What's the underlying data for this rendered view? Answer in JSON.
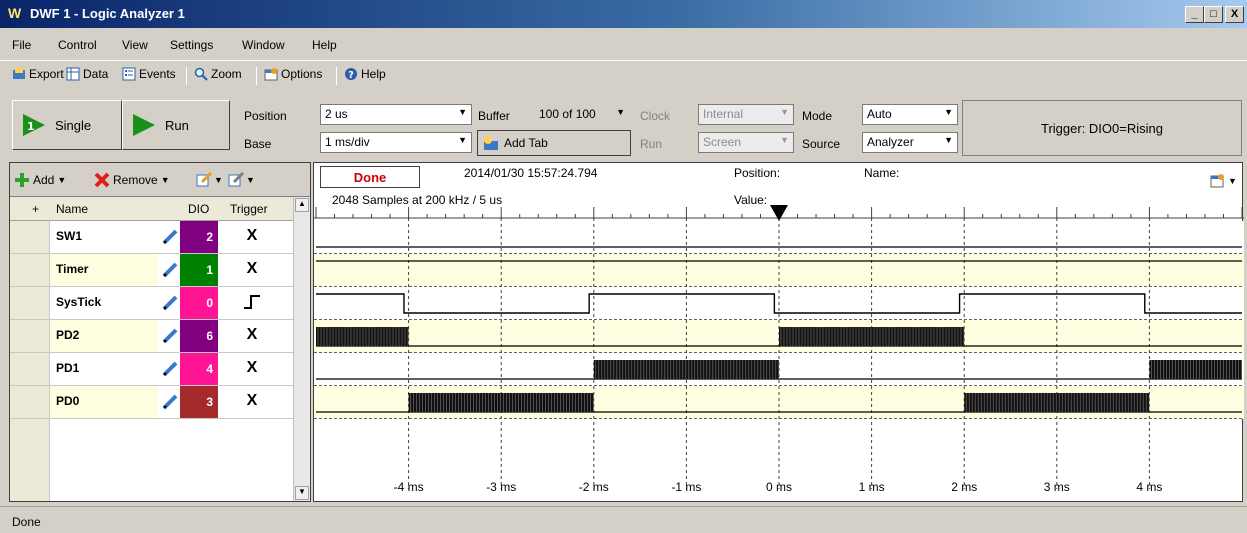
{
  "window": {
    "title": "DWF 1 - Logic Analyzer 1",
    "minimize": "_",
    "maximize": "□",
    "close": "X"
  },
  "menu": [
    "File",
    "Control",
    "View",
    "Settings",
    "Window",
    "Help"
  ],
  "toolbar": {
    "export": "Export",
    "data": "Data",
    "events": "Events",
    "zoom": "Zoom",
    "options": "Options",
    "help": "Help"
  },
  "control": {
    "single": "Single",
    "run": "Run",
    "position_label": "Position",
    "position_value": "2 us",
    "base_label": "Base",
    "base_value": "1 ms/div",
    "buffer_label": "Buffer",
    "buffer_value": "100 of 100",
    "add_tab": "Add Tab",
    "clock_label": "Clock",
    "clock_value": "Internal",
    "run_label": "Run",
    "run_value": "Screen",
    "mode_label": "Mode",
    "mode_value": "Auto",
    "source_label": "Source",
    "source_value": "Analyzer",
    "trigger_text": "Trigger: DIO0=Rising"
  },
  "channel_tools": {
    "add": "Add",
    "remove": "Remove"
  },
  "columns": {
    "plus": "+",
    "name": "Name",
    "dio": "DIO",
    "trigger": "Trigger"
  },
  "channels": [
    {
      "name": "SW1",
      "dio": "2",
      "trigger": "X",
      "dio_color": "#800080",
      "bg": "#ffffff"
    },
    {
      "name": "Timer",
      "dio": "1",
      "trigger": "X",
      "dio_color": "#008000",
      "bg": "#fffee0"
    },
    {
      "name": "SysTick",
      "dio": "0",
      "trigger": "rising-edge",
      "dio_color": "#ff1493",
      "bg": "#ffffff"
    },
    {
      "name": "PD2",
      "dio": "6",
      "trigger": "X",
      "dio_color": "#800080",
      "bg": "#fffee0"
    },
    {
      "name": "PD1",
      "dio": "4",
      "trigger": "X",
      "dio_color": "#ff1493",
      "bg": "#ffffff"
    },
    {
      "name": "PD0",
      "dio": "3",
      "trigger": "X",
      "dio_color": "#a52a2a",
      "bg": "#fffee0"
    }
  ],
  "acquisition": {
    "state": "Done",
    "timestamp": "2014/01/30  15:57:24.794",
    "samples": "2048 Samples at 200 kHz / 5 us",
    "position_label": "Position:",
    "value_label": "Value:",
    "name_label": "Name:"
  },
  "time_axis": {
    "labels": [
      "-4 ms",
      "-3 ms",
      "-2 ms",
      "-1 ms",
      "0 ms",
      "1 ms",
      "2 ms",
      "3 ms",
      "4 ms"
    ],
    "range_ms": [
      -5,
      5
    ]
  },
  "signals": {
    "SW1": {
      "type": "constant",
      "level": "low"
    },
    "Timer": {
      "type": "constant",
      "level": "high"
    },
    "SysTick": {
      "type": "digital",
      "initial": "high",
      "transitions_ms": [
        -4.05,
        -2.05,
        -0.05,
        1.95,
        3.95
      ]
    },
    "PD2": {
      "type": "burst",
      "active_ms": [
        [
          -5,
          -4
        ],
        [
          0,
          2
        ]
      ]
    },
    "PD1": {
      "type": "burst",
      "active_ms": [
        [
          -2,
          0
        ],
        [
          4,
          5
        ]
      ]
    },
    "PD0": {
      "type": "burst",
      "active_ms": [
        [
          -4,
          -2
        ],
        [
          2,
          4
        ]
      ]
    }
  },
  "status": {
    "text": "Done"
  }
}
